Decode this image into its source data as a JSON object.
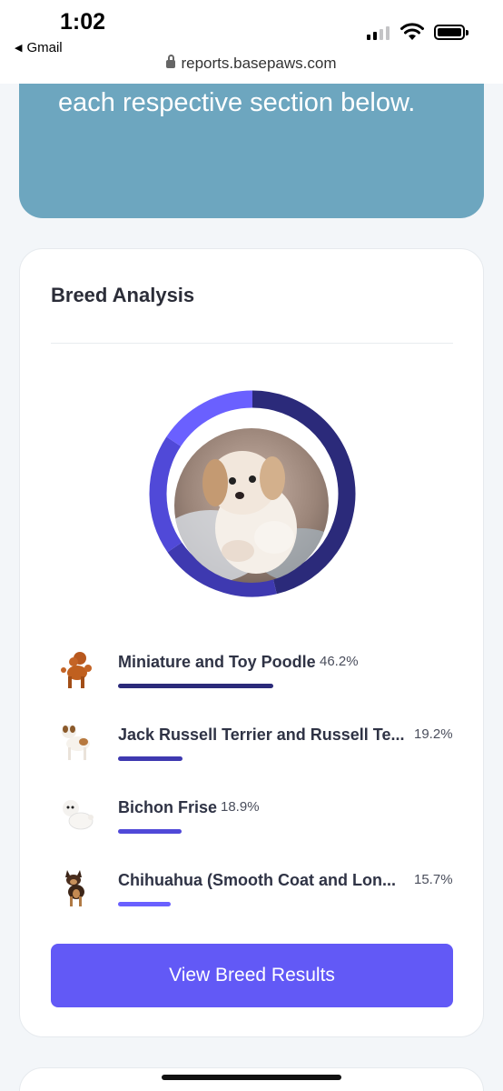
{
  "status_bar": {
    "time": "1:02",
    "back_app": "Gmail",
    "url": "reports.basepaws.com"
  },
  "banner": {
    "text": "each respective section below."
  },
  "breed_card": {
    "title": "Breed Analysis",
    "breeds": [
      {
        "name": "Miniature and Toy Poodle",
        "percent_label": "46.2%",
        "percent": 46.2,
        "color": "#2b2a7a",
        "icon": "poodle-icon"
      },
      {
        "name": "Jack Russell Terrier and Russell Te...",
        "percent_label": "19.2%",
        "percent": 19.2,
        "color": "#3e39b0",
        "icon": "jack-russell-icon"
      },
      {
        "name": "Bichon Frise",
        "percent_label": "18.9%",
        "percent": 18.9,
        "color": "#5049d8",
        "icon": "bichon-icon"
      },
      {
        "name": "Chihuahua (Smooth Coat and Lon...",
        "percent_label": "15.7%",
        "percent": 15.7,
        "color": "#6a60ff",
        "icon": "chihuahua-icon"
      }
    ],
    "cta_label": "View Breed Results"
  }
}
